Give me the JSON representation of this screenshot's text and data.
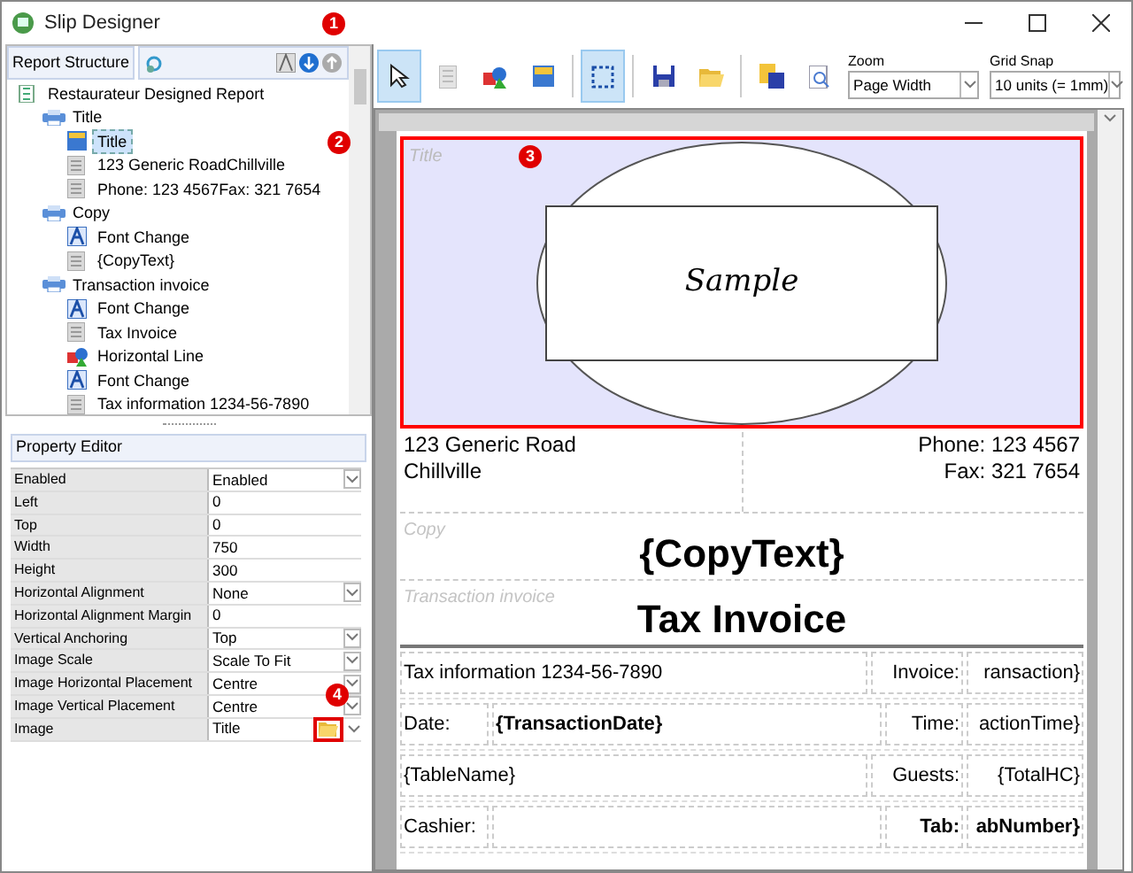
{
  "window": {
    "title": "Slip Designer",
    "badges": [
      "1",
      "2",
      "3",
      "4"
    ]
  },
  "structure": {
    "header": "Report Structure",
    "nodes": [
      {
        "label": "Restaurateur Designed Report",
        "kind": "report",
        "selected": false,
        "children": [
          {
            "label": "Title",
            "kind": "section",
            "selected": false,
            "children": [
              {
                "label": "Title",
                "kind": "image",
                "selected": true
              },
              {
                "label": "123 Generic RoadChillville",
                "kind": "text",
                "selected": false
              },
              {
                "label": "Phone: 123 4567Fax: 321 7654",
                "kind": "text",
                "selected": false
              }
            ]
          },
          {
            "label": "Copy",
            "kind": "section",
            "selected": false,
            "children": [
              {
                "label": "Font Change",
                "kind": "font",
                "selected": false
              },
              {
                "label": "{CopyText}",
                "kind": "text",
                "selected": false
              }
            ]
          },
          {
            "label": "Transaction invoice",
            "kind": "section",
            "selected": false,
            "children": [
              {
                "label": "Font Change",
                "kind": "font",
                "selected": false
              },
              {
                "label": "Tax Invoice",
                "kind": "text",
                "selected": false
              },
              {
                "label": "Horizontal Line",
                "kind": "shape",
                "selected": false
              },
              {
                "label": "Font Change",
                "kind": "font",
                "selected": false
              },
              {
                "label": "Tax information 1234-56-7890",
                "kind": "text",
                "selected": false
              }
            ]
          }
        ]
      }
    ]
  },
  "properties": {
    "header": "Property Editor",
    "rows": [
      {
        "name": "Enabled",
        "value": "Enabled",
        "kind": "dropdown"
      },
      {
        "name": "Left",
        "value": "0",
        "kind": "text"
      },
      {
        "name": "Top",
        "value": "0",
        "kind": "text"
      },
      {
        "name": "Width",
        "value": "750",
        "kind": "text"
      },
      {
        "name": "Height",
        "value": "300",
        "kind": "text"
      },
      {
        "name": "Horizontal Alignment",
        "value": "None",
        "kind": "dropdown"
      },
      {
        "name": "Horizontal Alignment Margin",
        "value": "0",
        "kind": "text"
      },
      {
        "name": "Vertical Anchoring",
        "value": "Top",
        "kind": "dropdown"
      },
      {
        "name": "Image Scale",
        "value": "Scale To Fit",
        "kind": "dropdown"
      },
      {
        "name": "Image Horizontal Placement",
        "value": "Centre",
        "kind": "dropdown"
      },
      {
        "name": "Image Vertical Placement",
        "value": "Centre",
        "kind": "dropdown"
      },
      {
        "name": "Image",
        "value": "Title",
        "kind": "image"
      }
    ]
  },
  "toolbar": {
    "tools": [
      {
        "kind": "pointer",
        "selected": true
      },
      {
        "kind": "text",
        "selected": false
      },
      {
        "kind": "shape",
        "selected": false
      },
      {
        "kind": "image",
        "selected": false
      },
      {
        "kind": "separator"
      },
      {
        "kind": "select-area",
        "selected": true
      },
      {
        "kind": "separator"
      },
      {
        "kind": "save",
        "selected": false
      },
      {
        "kind": "open",
        "selected": false
      },
      {
        "kind": "separator"
      },
      {
        "kind": "save-as",
        "selected": false
      },
      {
        "kind": "preview",
        "selected": false
      }
    ],
    "zoom": {
      "label": "Zoom",
      "value": "Page Width"
    },
    "grid_snap": {
      "label": "Grid Snap",
      "value": "10 units (= 1mm)"
    }
  },
  "report": {
    "title_band": {
      "label": "Title",
      "image_text": "Sample",
      "selected": true
    },
    "address": [
      "123 Generic Road",
      "Chillville"
    ],
    "phone": [
      "Phone: 123 4567",
      "Fax: 321 7654"
    ],
    "copy_band": {
      "label": "Copy",
      "text": "{CopyText}"
    },
    "transaction_band": {
      "label": "Transaction invoice",
      "text": "Tax Invoice"
    },
    "rows": [
      {
        "kind": "three",
        "cells": [
          {
            "kind": "text",
            "text": "Tax information 1234-56-7890",
            "bold": false
          },
          {
            "kind": "text",
            "text": "Invoice:",
            "bold": false
          },
          {
            "kind": "text",
            "text": "ransaction}",
            "bold": false
          }
        ]
      },
      {
        "kind": "four",
        "cells": [
          {
            "kind": "text",
            "text": "Date:",
            "bold": false
          },
          {
            "kind": "text",
            "text": "{TransactionDate}",
            "bold": true
          },
          {
            "kind": "text",
            "text": "Time:",
            "bold": false
          },
          {
            "kind": "text",
            "text": "actionTime}",
            "bold": false
          }
        ]
      },
      {
        "kind": "three",
        "cells": [
          {
            "kind": "text",
            "text": "{TableName}",
            "bold": false
          },
          {
            "kind": "text",
            "text": "Guests:",
            "bold": false
          },
          {
            "kind": "text",
            "text": "{TotalHC}",
            "bold": false
          }
        ]
      },
      {
        "kind": "four",
        "cells": [
          {
            "kind": "text",
            "text": "Cashier:",
            "bold": false
          },
          {
            "kind": "blank"
          },
          {
            "kind": "text",
            "text": "Tab:",
            "bold": true
          },
          {
            "kind": "text",
            "text": "abNumber}",
            "bold": true
          }
        ]
      }
    ]
  }
}
